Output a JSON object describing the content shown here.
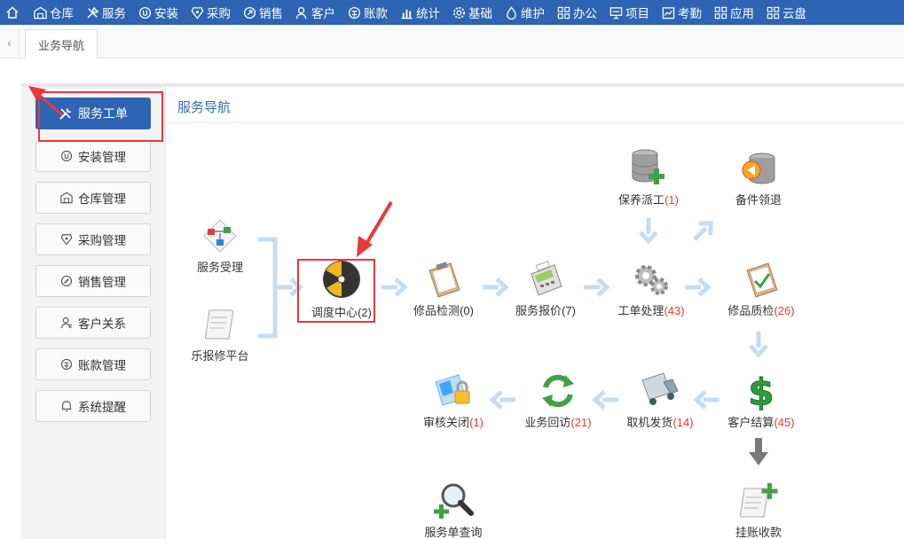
{
  "topnav": {
    "items": [
      {
        "label": "仓库",
        "icon": "warehouse-icon"
      },
      {
        "label": "服务",
        "icon": "tools-icon"
      },
      {
        "label": "安装",
        "icon": "install-icon"
      },
      {
        "label": "采购",
        "icon": "purchase-icon"
      },
      {
        "label": "销售",
        "icon": "sales-icon"
      },
      {
        "label": "客户",
        "icon": "customer-icon"
      },
      {
        "label": "账款",
        "icon": "account-icon"
      },
      {
        "label": "统计",
        "icon": "chart-icon"
      },
      {
        "label": "基础",
        "icon": "gear-icon"
      },
      {
        "label": "维护",
        "icon": "maintain-icon"
      },
      {
        "label": "办公",
        "icon": "office-icon"
      },
      {
        "label": "项目",
        "icon": "project-icon"
      },
      {
        "label": "考勤",
        "icon": "attendance-icon"
      },
      {
        "label": "应用",
        "icon": "apps-icon"
      },
      {
        "label": "云盘",
        "icon": "cloud-icon"
      }
    ]
  },
  "tabs": {
    "active": "业务导航"
  },
  "sidebar": {
    "items": [
      {
        "label": "服务工单",
        "icon": "tools-icon",
        "active": true
      },
      {
        "label": "安装管理",
        "icon": "install-icon"
      },
      {
        "label": "仓库管理",
        "icon": "warehouse-icon"
      },
      {
        "label": "采购管理",
        "icon": "purchase-icon"
      },
      {
        "label": "销售管理",
        "icon": "sales-icon"
      },
      {
        "label": "客户关系",
        "icon": "customer-icon"
      },
      {
        "label": "账款管理",
        "icon": "account-icon"
      },
      {
        "label": "系统提醒",
        "icon": "bell-icon"
      }
    ]
  },
  "content": {
    "title": "服务导航",
    "nodes": {
      "service_accept": {
        "label": "服务受理"
      },
      "repair_platform": {
        "label": "乐报修平台"
      },
      "dispatch_center": {
        "label": "调度中心",
        "count": "(2)"
      },
      "repair_inspection": {
        "label": "修品检测",
        "count": "(0)"
      },
      "service_quote": {
        "label": "服务报价",
        "count": "(7)"
      },
      "work_order": {
        "label": "工单处理",
        "count": "(43)"
      },
      "maintenance_dispatch": {
        "label": "保养派工",
        "count": "(1)"
      },
      "parts_pickup": {
        "label": "备件领退"
      },
      "quality_check": {
        "label": "修品质检",
        "count": "(26)"
      },
      "customer_settlement": {
        "label": "客户结算",
        "count": "(45)"
      },
      "pickup_delivery": {
        "label": "取机发货",
        "count": "(14)"
      },
      "business_visit": {
        "label": "业务回访",
        "count": "(21)"
      },
      "audit_close": {
        "label": "审核关闭",
        "count": "(1)"
      },
      "order_query": {
        "label": "服务单查询"
      },
      "credit_collection": {
        "label": "挂账收款"
      }
    }
  },
  "colors": {
    "nav": "#2d64b3",
    "accent_red": "#e8393b",
    "count_red": "#e53935",
    "flow_arrow": "#c6ddf0"
  }
}
